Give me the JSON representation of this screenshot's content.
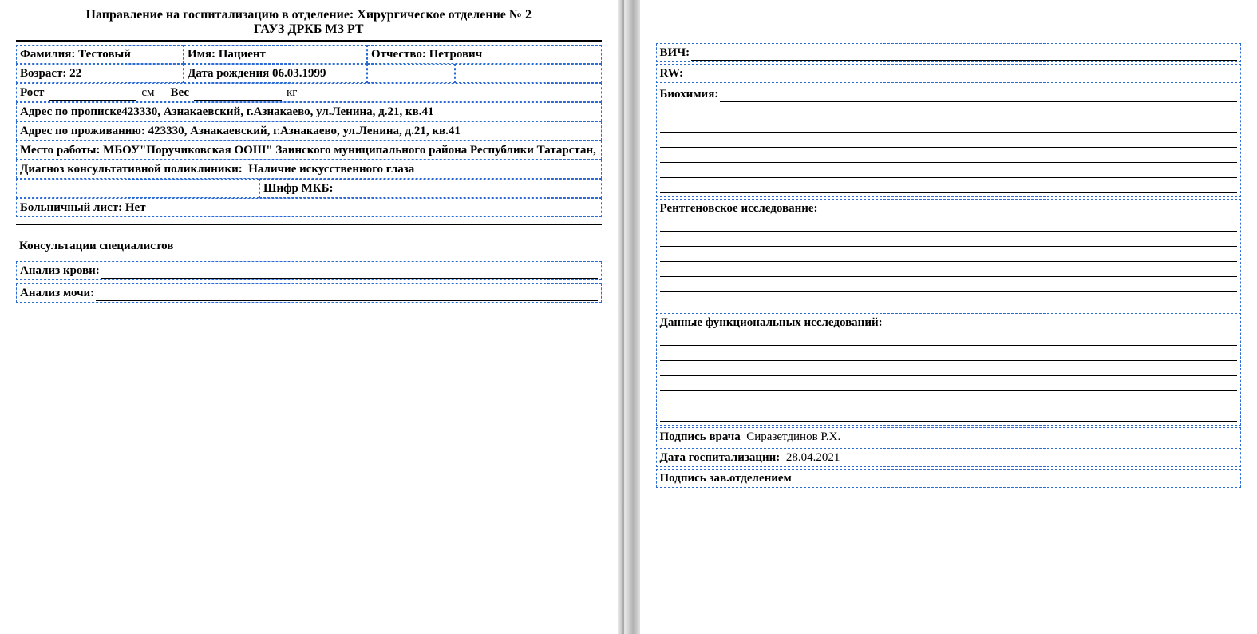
{
  "header": {
    "title_line1": "Направление на госпитализацию в отделение: Хирургическое отделение № 2",
    "title_line2": "ГАУЗ ДРКБ МЗ РТ"
  },
  "patient": {
    "surname_label": "Фамилия:",
    "surname": "Тестовый",
    "name_label": "Имя:",
    "name": "Пациент",
    "patronymic_label": "Отчество:",
    "patronymic": "Петрович",
    "age_label": "Возраст:",
    "age": "22",
    "dob_label": "Дата рождения",
    "dob": "06.03.1999",
    "height_label": "Рост",
    "height_unit": "см",
    "weight_label": "Вес",
    "weight_unit": "кг",
    "reg_address_label": "Адрес по прописке",
    "reg_address": "423330, Азнакаевский, г.Азнакаево, ул.Ленина, д.21, кв.41",
    "res_address_label": "Адрес по проживанию:",
    "res_address": "423330, Азнакаевский, г.Азнакаево, ул.Ленина, д.21, кв.41",
    "work_label": "Место работы:",
    "work": "МБОУ\"Поручиковская ООШ\" Заинского муниципального района Республики Татарстан,",
    "diagnosis_label": "Диагноз консультативной поликлиники:",
    "diagnosis": "Наличие искусственного глаза",
    "mkb_label": "Шифр МКБ:",
    "sick_leave_label": "Больничный лист:",
    "sick_leave": "Нет"
  },
  "consult": {
    "heading": "Консультации специалистов",
    "blood_label": "Анализ крови:",
    "urine_label": "Анализ мочи:"
  },
  "page2": {
    "hiv_label": "ВИЧ:",
    "rw_label": "RW:",
    "biochem_label": "Биохимия:",
    "xray_label": "Рентгеновское исследование:",
    "func_label": "Данные функциональных исследований:",
    "doc_sign_label": "Подпись врача",
    "doc_sign": "Сиразетдинов Р.Х.",
    "hosp_date_label": "Дата госпитализации:",
    "hosp_date": "28.04.2021",
    "head_sign_label": "Подпись зав.отделением"
  }
}
